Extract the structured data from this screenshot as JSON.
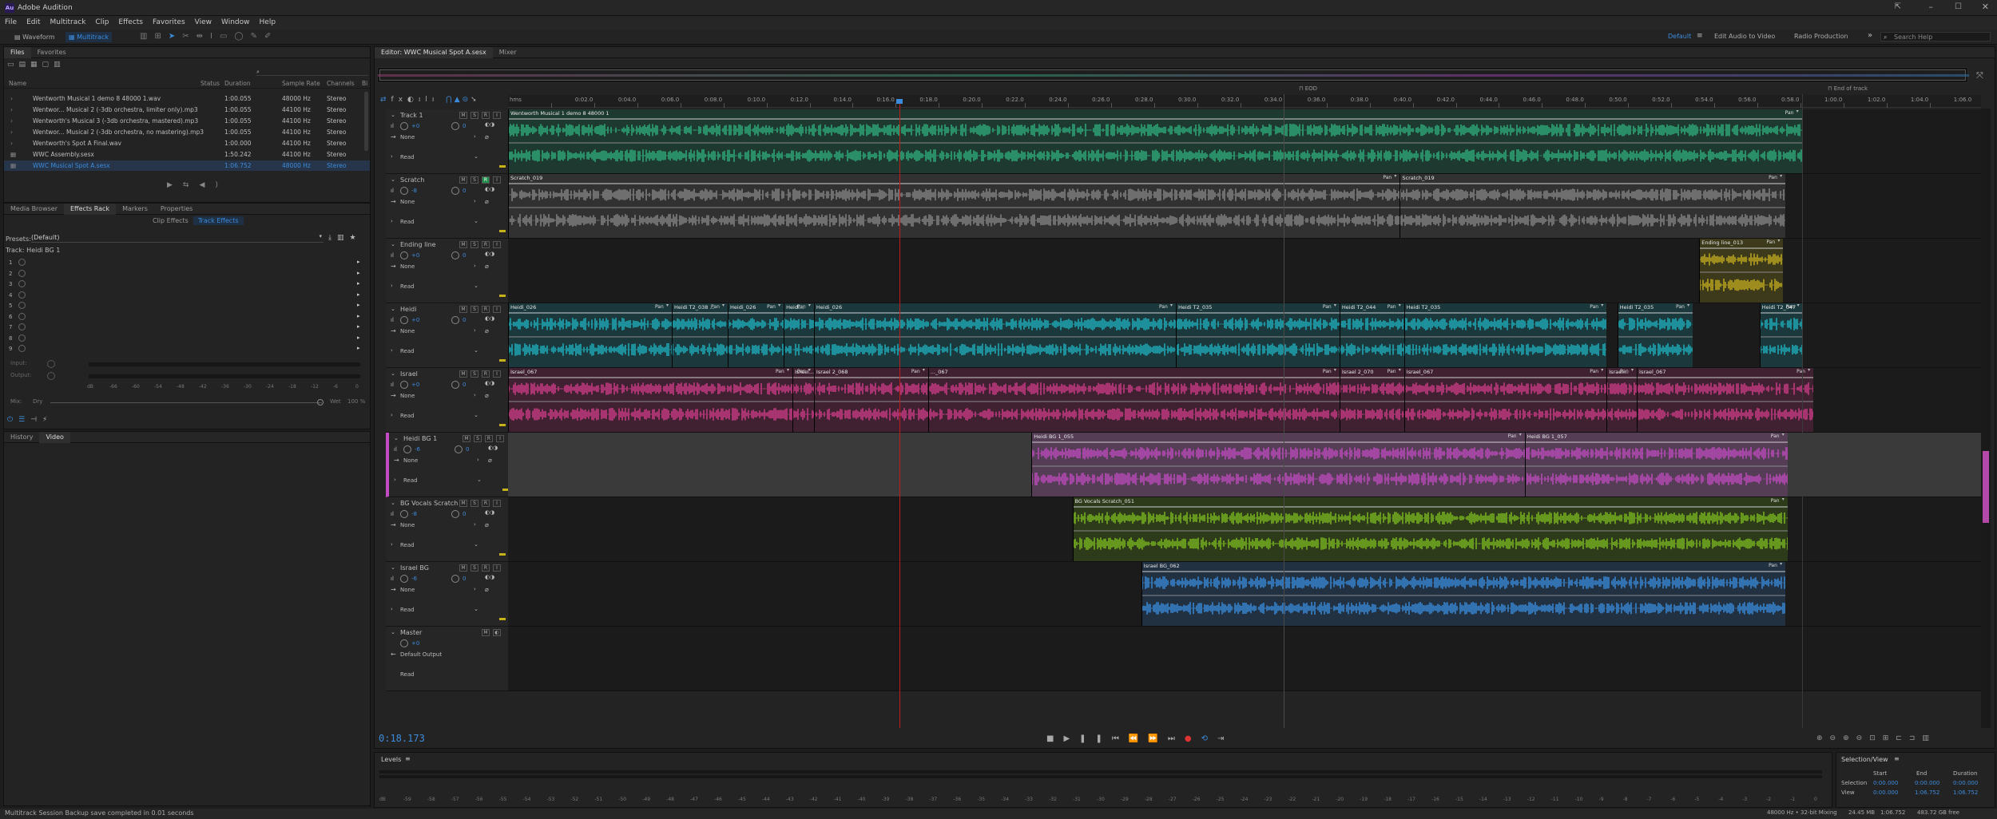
{
  "app": {
    "title": "Adobe Audition",
    "logo": "Au"
  },
  "menu": [
    "File",
    "Edit",
    "Multitrack",
    "Clip",
    "Effects",
    "Favorites",
    "View",
    "Window",
    "Help"
  ],
  "toolbar": {
    "waveform": "Waveform",
    "multitrack": "Multitrack"
  },
  "workspaces": [
    "Default",
    "Edit Audio to Video",
    "Radio Production"
  ],
  "search_help": "Search Help",
  "files_panel": {
    "tabs": [
      "Files",
      "Favorites"
    ],
    "columns": [
      "Name",
      "Status",
      "Duration",
      "Sample Rate",
      "Channels",
      "Bi"
    ],
    "rows": [
      {
        "name": "Wentworth Musical 1 demo 8 48000 1.wav",
        "duration": "1:00.055",
        "rate": "48000 Hz",
        "channels": "Stereo"
      },
      {
        "name": "Wentwor... Musical 2 (-3db orchestra, limiter only).mp3",
        "duration": "1:00.055",
        "rate": "44100 Hz",
        "channels": "Stereo"
      },
      {
        "name": "Wentworth's Musical 3 (-3db orchestra, mastered).mp3",
        "duration": "1:00.055",
        "rate": "44100 Hz",
        "channels": "Stereo"
      },
      {
        "name": "Wentwor... Musical 2 (-3db orchestra, no mastering).mp3",
        "duration": "1:00.055",
        "rate": "44100 Hz",
        "channels": "Stereo"
      },
      {
        "name": "Wentworth's Spot A Final.wav",
        "duration": "1:00.000",
        "rate": "44100 Hz",
        "channels": "Stereo"
      },
      {
        "name": "WWC Assembly.sesx",
        "duration": "1:50.242",
        "rate": "44100 Hz",
        "channels": "Stereo"
      },
      {
        "name": "WWC Musical Spot A.sesx",
        "duration": "1:06.752",
        "rate": "48000 Hz",
        "channels": "Stereo"
      }
    ]
  },
  "effects_panel": {
    "tabs": [
      "Media Browser",
      "Effects Rack",
      "Markers",
      "Properties"
    ],
    "subtabs": [
      "Clip Effects",
      "Track Effects"
    ],
    "presets_label": "Presets:",
    "presets_value": "(Default)",
    "track_label": "Track: Heidi BG 1",
    "slots": [
      "1",
      "2",
      "3",
      "4",
      "5",
      "6",
      "7",
      "8",
      "9"
    ],
    "input_label": "Input:",
    "output_label": "Output:",
    "mix_label": "Mix:",
    "dry_label": "Dry",
    "wet_label": "Wet",
    "wet_value": "100 %"
  },
  "history_panel": {
    "tabs": [
      "History",
      "Video"
    ]
  },
  "editor": {
    "tabs": [
      "Editor: WWC Musical Spot A.sesx",
      "Mixer"
    ],
    "eod": "EOD",
    "end_of_track": "End of track",
    "time_format": "hms",
    "ruler": [
      "0:02.0",
      "0:04.0",
      "0:06.0",
      "0:08.0",
      "0:10.0",
      "0:12.0",
      "0:14.0",
      "0:16.0",
      "0:18.0",
      "0:20.0",
      "0:22.0",
      "0:24.0",
      "0:26.0",
      "0:28.0",
      "0:30.0",
      "0:32.0",
      "0:34.0",
      "0:36.0",
      "0:38.0",
      "0:40.0",
      "0:42.0",
      "0:44.0",
      "0:46.0",
      "0:48.0",
      "0:50.0",
      "0:52.0",
      "0:54.0",
      "0:56.0",
      "0:58.0",
      "1:00.0",
      "1:02.0",
      "1:04.0",
      "1:06.0"
    ],
    "current_time": "0:18.173"
  },
  "tracks": [
    {
      "name": "Track 1",
      "vol": "+0",
      "pan": "0",
      "input": "None",
      "mode": "Read",
      "color": "#2fb380",
      "clips": [
        {
          "label": "Wentworth Musical 1 demo 8 48000 1",
          "start": 0.0,
          "end": 60.06
        }
      ]
    },
    {
      "name": "Scratch",
      "vol": "-8",
      "pan": "0",
      "input": "None",
      "mode": "Read",
      "color": "#8a8a8a",
      "clips": [
        {
          "label": "Scratch_019",
          "start": 0.0,
          "end": 41.4
        },
        {
          "label": "Scratch_019",
          "start": 41.4,
          "end": 59.3
        }
      ]
    },
    {
      "name": "Ending line",
      "vol": "+0",
      "pan": "0",
      "input": "None",
      "mode": "Read",
      "color": "#c9b21f",
      "clips": [
        {
          "label": "Ending line_013",
          "start": 55.3,
          "end": 59.2
        }
      ]
    },
    {
      "name": "Heidi",
      "vol": "+0",
      "pan": "0",
      "input": "None",
      "mode": "Read",
      "color": "#1fb6c4",
      "clips": [
        {
          "label": "Heidi_026",
          "start": 0.0,
          "end": 7.6
        },
        {
          "label": "Heidi T2_038 ...",
          "start": 7.6,
          "end": 10.2
        },
        {
          "label": "Heidi_026",
          "start": 10.2,
          "end": 12.8
        },
        {
          "label": "Heidi...",
          "start": 12.8,
          "end": 14.2
        },
        {
          "label": "Heidi_026",
          "start": 14.2,
          "end": 31.0
        },
        {
          "label": "Heidi T2_035",
          "start": 31.0,
          "end": 38.6
        },
        {
          "label": "Heidi T2_044",
          "start": 38.6,
          "end": 41.6
        },
        {
          "label": "Heidi T2_035",
          "start": 41.6,
          "end": 51.0
        },
        {
          "label": "Heidi T2_035",
          "start": 51.5,
          "end": 55.0
        },
        {
          "label": "Heidi T2_047",
          "start": 58.1,
          "end": 60.1
        }
      ]
    },
    {
      "name": "Israel",
      "vol": "+0",
      "pan": "0",
      "input": "None",
      "mode": "Read",
      "color": "#d43e8c",
      "clips": [
        {
          "label": "Israel_067",
          "start": 0.0,
          "end": 13.2
        },
        {
          "label": "Israel...",
          "start": 13.2,
          "end": 14.2
        },
        {
          "label": "Israel 2_068",
          "start": 14.2,
          "end": 19.5
        },
        {
          "label": "..._067",
          "start": 19.5,
          "end": 38.6
        },
        {
          "label": "Israel 2_070",
          "start": 38.6,
          "end": 41.6
        },
        {
          "label": "Israel_067",
          "start": 41.6,
          "end": 51.0
        },
        {
          "label": "Israel...",
          "start": 51.0,
          "end": 52.4
        },
        {
          "label": "Israel_067",
          "start": 52.4,
          "end": 60.6
        }
      ]
    },
    {
      "name": "Heidi BG 1",
      "vol": "-6",
      "pan": "0",
      "input": "None",
      "mode": "Read",
      "color": "#c24cc4",
      "clips": [
        {
          "label": "Heidi BG 1_055",
          "start": 24.3,
          "end": 47.2
        },
        {
          "label": "Heidi BG 1_057",
          "start": 47.2,
          "end": 59.4
        }
      ]
    },
    {
      "name": "BG Vocals Scratch",
      "vol": "-8",
      "pan": "0",
      "input": "None",
      "mode": "Read",
      "color": "#7fbf1f",
      "clips": [
        {
          "label": "BG Vocals Scratch_051",
          "start": 26.2,
          "end": 59.4
        }
      ]
    },
    {
      "name": "Israel BG",
      "vol": "-6",
      "pan": "0",
      "input": "None",
      "mode": "Read",
      "color": "#3a8ee0",
      "clips": [
        {
          "label": "Israel BG_062",
          "start": 29.4,
          "end": 59.3
        }
      ]
    }
  ],
  "master": {
    "name": "Master",
    "vol": "+0",
    "output": "Default Output",
    "mode": "Read"
  },
  "pan_label": "Pan",
  "levels": {
    "title": "Levels",
    "scale": [
      "dB",
      "-59",
      "-58",
      "-57",
      "-56",
      "-55",
      "-54",
      "-53",
      "-52",
      "-51",
      "-50",
      "-49",
      "-48",
      "-47",
      "-46",
      "-45",
      "-44",
      "-43",
      "-42",
      "-41",
      "-40",
      "-39",
      "-38",
      "-37",
      "-36",
      "-35",
      "-34",
      "-33",
      "-32",
      "-31",
      "-30",
      "-29",
      "-28",
      "-27",
      "-26",
      "-25",
      "-24",
      "-23",
      "-22",
      "-21",
      "-20",
      "-19",
      "-18",
      "-17",
      "-16",
      "-15",
      "-14",
      "-13",
      "-12",
      "-11",
      "-10",
      "-9",
      "-8",
      "-7",
      "-6",
      "-5",
      "-4",
      "-3",
      "-2",
      "-1",
      "0"
    ]
  },
  "selection_view": {
    "title": "Selection/View",
    "headers": [
      "Start",
      "End",
      "Duration"
    ],
    "selection": {
      "label": "Selection",
      "start": "0:00.000",
      "end": "0:00.000",
      "duration": "0:00.000"
    },
    "view": {
      "label": "View",
      "start": "0:00.000",
      "end": "1:06.752",
      "duration": "1:06.752"
    }
  },
  "status": {
    "message": "Multitrack Session Backup save completed in 0.01 seconds",
    "format": "48000 Hz • 32-bit Mixing",
    "size": "24.45 MB",
    "duration": "1:06.752",
    "free": "483.72 GB free"
  },
  "meter_scale": [
    "dB",
    "-66",
    "-60",
    "-54",
    "-48",
    "-42",
    "-36",
    "-30",
    "-24",
    "-18",
    "-12",
    "-6",
    "0"
  ]
}
